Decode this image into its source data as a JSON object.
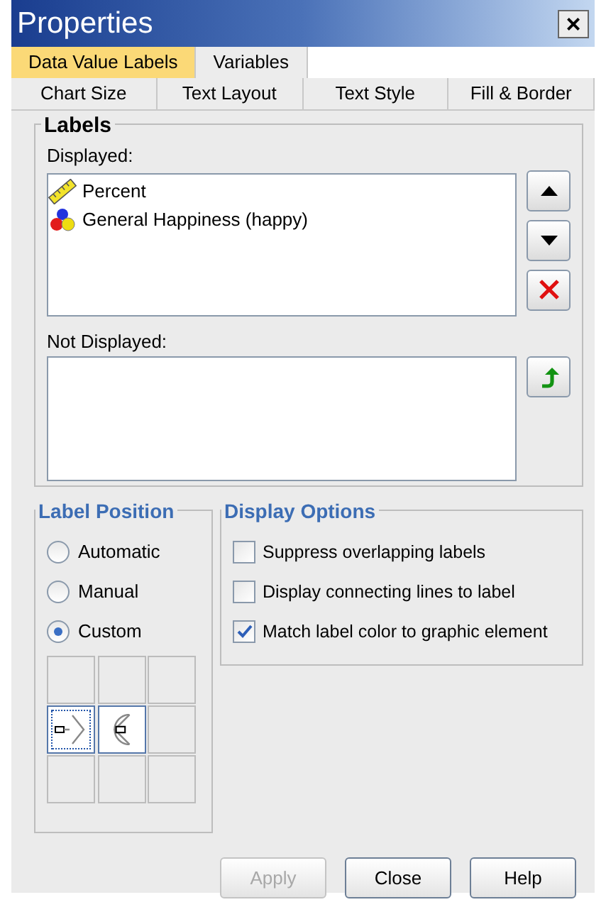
{
  "window": {
    "title": "Properties",
    "close": "×"
  },
  "tab_rows": [
    [
      {
        "label": "Data Value Labels",
        "selected": true
      },
      {
        "label": "Variables",
        "selected": false
      }
    ],
    [
      {
        "label": "Chart Size",
        "selected": false
      },
      {
        "label": "Text Layout",
        "selected": false
      },
      {
        "label": "Text Style",
        "selected": false
      },
      {
        "label": "Fill & Border",
        "selected": false
      }
    ]
  ],
  "labels_group": {
    "title": "Labels",
    "displayed_label": "Displayed:",
    "displayed": [
      {
        "kind": "scale",
        "label": "Percent"
      },
      {
        "kind": "nominal",
        "label": "General Happiness (happy)"
      }
    ],
    "not_displayed_label": "Not Displayed:"
  },
  "label_position": {
    "title": "Label Position",
    "options": [
      {
        "label": "Automatic",
        "selected": false
      },
      {
        "label": "Manual",
        "selected": false
      },
      {
        "label": "Custom",
        "selected": true
      }
    ],
    "cells": [
      {
        "kind": "blank",
        "selected": false
      },
      {
        "kind": "blank",
        "selected": false
      },
      {
        "kind": "blank",
        "selected": false
      },
      {
        "kind": "outside",
        "selected": true
      },
      {
        "kind": "inside",
        "selected": false
      },
      {
        "kind": "blank",
        "selected": false
      },
      {
        "kind": "blank",
        "selected": false
      },
      {
        "kind": "blank",
        "selected": false
      },
      {
        "kind": "blank",
        "selected": false
      }
    ]
  },
  "display_options": {
    "title": "Display Options",
    "options": [
      {
        "label": "Suppress overlapping labels",
        "checked": false
      },
      {
        "label": "Display connecting lines to label",
        "checked": false
      },
      {
        "label": "Match label color to graphic element",
        "checked": true
      }
    ]
  },
  "buttons": [
    {
      "label": "Apply",
      "disabled": true
    },
    {
      "label": "Close",
      "disabled": false
    },
    {
      "label": "Help",
      "disabled": false
    }
  ]
}
